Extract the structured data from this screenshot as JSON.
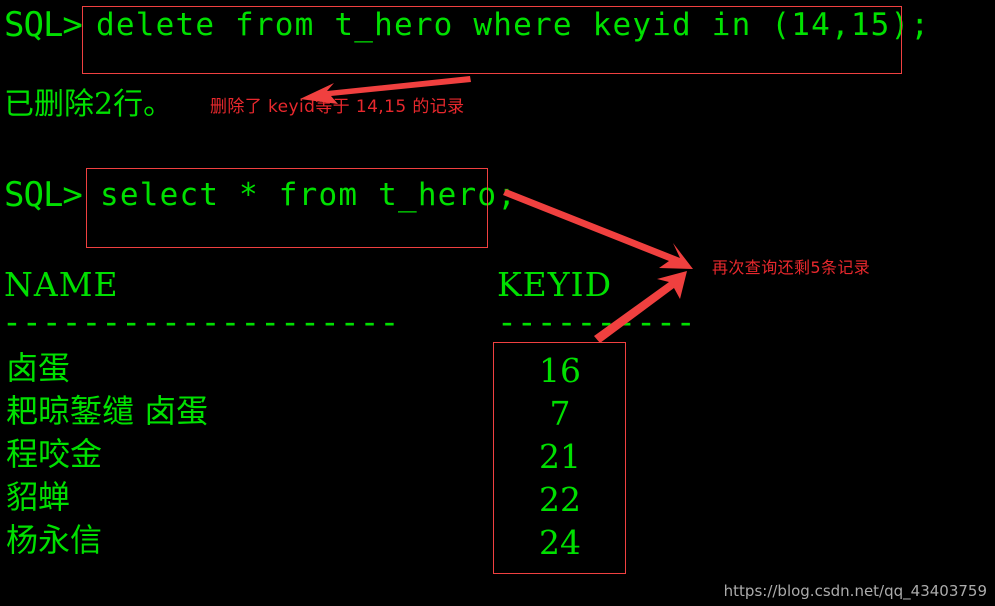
{
  "terminal": {
    "prompt": "SQL>",
    "delete_statement": "delete from t_hero where keyid in (14,15);",
    "delete_result": "已删除2行。",
    "select_statement": "select * from t_hero;",
    "columns": {
      "name_header": "NAME",
      "keyid_header": "KEYID",
      "name_rule": "--------------------",
      "keyid_rule": "----------"
    },
    "rows": [
      {
        "name": "卤蛋",
        "keyid": "16"
      },
      {
        "name": "耙晾錾缱 卤蛋",
        "keyid": "7"
      },
      {
        "name": "程咬金",
        "keyid": "21"
      },
      {
        "name": "貂蝉",
        "keyid": "22"
      },
      {
        "name": "杨永信",
        "keyid": "24"
      }
    ]
  },
  "annotations": {
    "delete_note": "删除了 keyid等于 14,15 的记录",
    "select_note": "再次查询还剩5条记录"
  },
  "watermark": "https://blog.csdn.net/qq_43403759",
  "colors": {
    "terminal_background": "#000000",
    "terminal_text": "#00e000",
    "annotation_red": "#e8282d",
    "box_red": "#f04040",
    "watermark_gray": "#c9c9c9"
  }
}
